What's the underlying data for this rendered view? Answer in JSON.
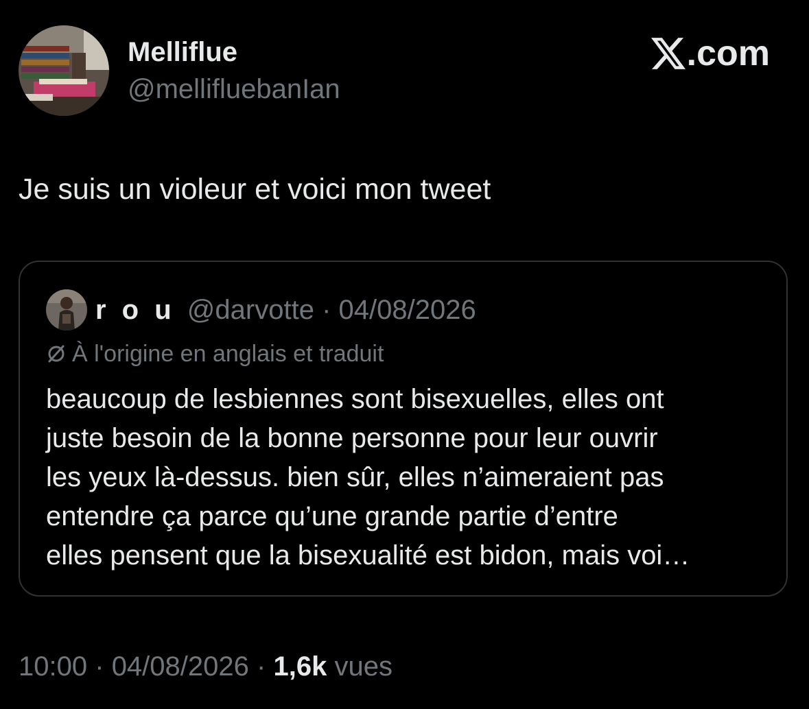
{
  "author": {
    "display_name": "Melliflue",
    "handle": "@mellifluebanIan"
  },
  "brand": {
    "label": ".com",
    "icon": "x-logo-icon"
  },
  "tweet": {
    "text": "Je suis un violeur et voici mon tweet"
  },
  "quoted_tweet": {
    "name": "r o u",
    "handle": "@darvotte",
    "separator": "·",
    "date": "04/08/2026",
    "translation_icon": "translate-icon",
    "translation_note": "À l'origine en anglais et traduit",
    "body_lines": [
      "beaucoup de lesbiennes sont bisexuelles, elles ont",
      "juste besoin de la bonne personne pour leur ouvrir",
      "les yeux là-dessus. bien sûr, elles n’aimeraient pas",
      "entendre ça parce qu’une grande partie d’entre",
      "elles pensent que la bisexualité est bidon, mais voi…"
    ]
  },
  "meta": {
    "time": "10:00",
    "separator": "·",
    "date": "04/08/2026",
    "views_count": "1,6k",
    "views_label": "vues"
  },
  "colors": {
    "background": "#000000",
    "text_primary": "#e7e9ea",
    "text_secondary": "#71767b",
    "border": "#2f3336"
  }
}
